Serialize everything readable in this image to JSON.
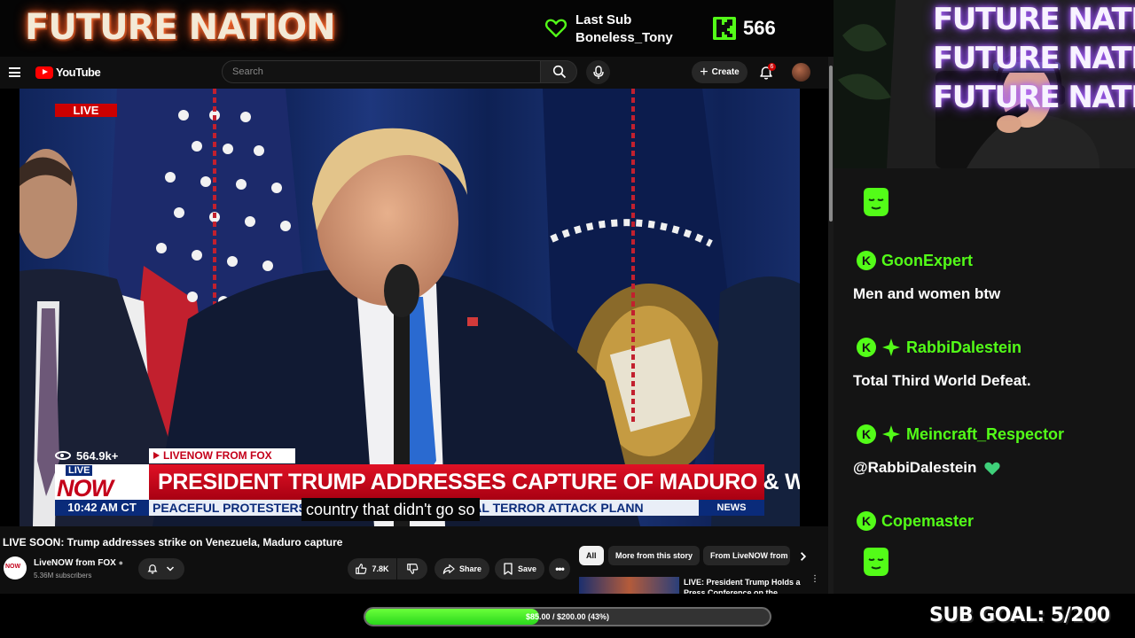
{
  "overlay": {
    "brand_title": "FUTURE NATION",
    "last_sub_label": "Last Sub",
    "last_sub_name": "Boneless_Tony",
    "kick_count": "566",
    "accent_green": "#53fc18"
  },
  "youtube": {
    "logo_text": "YouTube",
    "search_placeholder": "Search",
    "create_label": "Create",
    "notifications_count": "6"
  },
  "video": {
    "live_badge": "LIVE",
    "lower_third": {
      "views": "564.9k+",
      "source": "LIVENOW FROM FOX",
      "logo_top": "LIVE",
      "logo_bottom": "NOW",
      "headline": "PRESIDENT TRUMP ADDRESSES CAPTURE OF MADURO & WIFE",
      "time": "10:42 AM CT",
      "ticker": "PEACEFUL PROTESTERS",
      "ticker_tail": "AL TERROR ATTACK PLANN",
      "ticker_right": "NEWS"
    },
    "caption": "country that didn't go so",
    "title": "LIVE SOON: Trump addresses strike on Venezuela, Maduro capture"
  },
  "channel": {
    "name": "LiveNOW from FOX",
    "subscribers": "5.36M subscribers"
  },
  "actions": {
    "likes": "7.8K",
    "share": "Share",
    "save": "Save"
  },
  "chips": [
    "All",
    "More from this story",
    "From LiveNOW from"
  ],
  "related": {
    "title": "LIVE: President Trump Holds a Press Conference on the"
  },
  "goal": {
    "progress_text": "$85.00 / $200.00 (43%)",
    "progress": 0.43,
    "sub_goal": "SUB GOAL: 5/200"
  },
  "chat": {
    "messages": [
      {
        "user": "GoonExpert",
        "text": "Men and women btw"
      },
      {
        "user": "RabbiDalestein",
        "text": "Total Third World Defeat."
      },
      {
        "user": "Meincraft_Respector",
        "text": "@RabbiDalestein"
      },
      {
        "user": "Copemaster",
        "text": ""
      }
    ]
  },
  "icons": {
    "heart": "heart-icon",
    "kick": "kick-logo-icon",
    "search": "search-icon",
    "mic": "mic-icon",
    "bell": "bell-icon",
    "like": "thumbs-up-icon",
    "dislike": "thumbs-down-icon",
    "share": "share-icon",
    "save": "bookmark-icon"
  }
}
